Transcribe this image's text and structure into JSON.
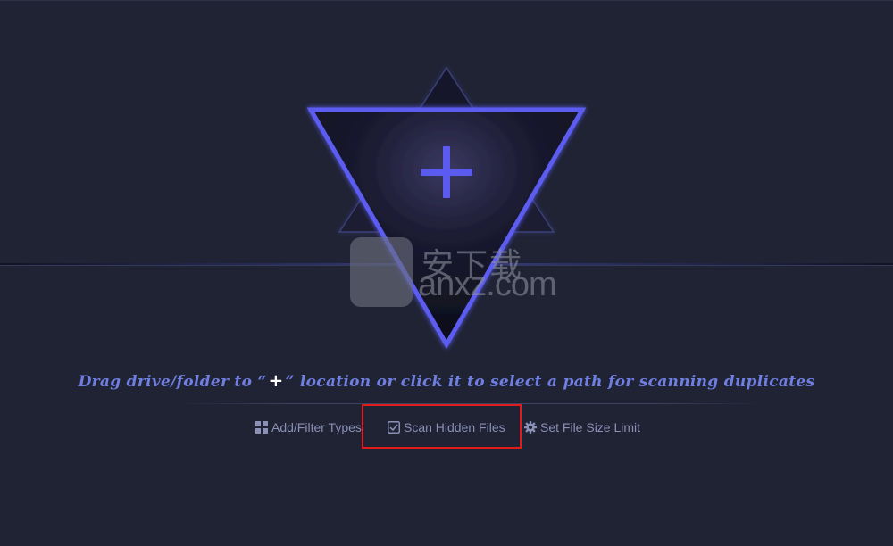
{
  "colors": {
    "background": "#1f2333",
    "accent": "#5b5bf0",
    "caption": "#6f7ee0",
    "option_text": "#8a90b6",
    "highlight": "#e21b1b"
  },
  "drop_area": {
    "icon": "plus-icon"
  },
  "instructions": {
    "before": "Drag drive/folder to “",
    "plus": "+",
    "after": "” location or click it to select a path for scanning duplicates"
  },
  "options": {
    "add_filter": {
      "label": "Add/Filter Types",
      "icon": "grid-icon"
    },
    "scan_hidden": {
      "label": "Scan Hidden Files",
      "icon": "checkbox-icon",
      "checked": true
    },
    "size_limit": {
      "label": "Set File Size Limit",
      "icon": "gear-icon"
    }
  },
  "watermark": {
    "cjk": "安下载",
    "domain": "anxz.com"
  }
}
